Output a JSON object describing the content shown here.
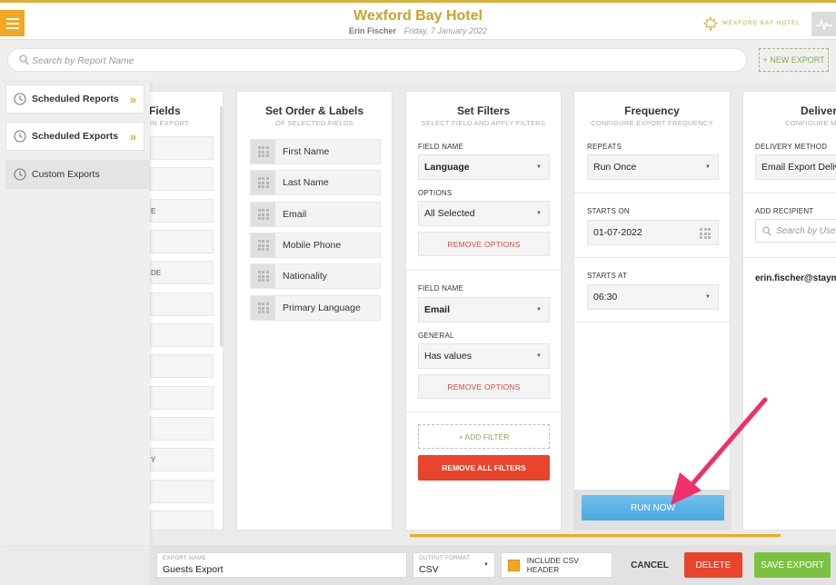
{
  "header": {
    "title": "Wexford Bay Hotel",
    "user": "Erin Fischer",
    "date": "Friday, 7 January 2022",
    "logo_text": "WEXFORD BAY HOTEL",
    "icons": {
      "menu": "hamburger-icon",
      "activity": "pulse-icon",
      "logo": "maple-leaf-icon"
    }
  },
  "search": {
    "placeholder": "Search by Report Name",
    "new_export_label": "+ NEW EXPORT"
  },
  "drawer": {
    "items": [
      {
        "label": "Scheduled Reports",
        "chevron": "»"
      },
      {
        "label": "Scheduled Exports",
        "chevron": "»"
      },
      {
        "label": "Custom Exports"
      }
    ]
  },
  "fields": {
    "title": "Fields",
    "subtitle": "IN EXPORT",
    "stubs": [
      "",
      "",
      "E",
      "",
      "DE",
      "",
      "",
      "",
      "",
      "",
      "Y",
      "",
      ""
    ]
  },
  "order": {
    "title": "Set Order & Labels",
    "subtitle": "OF SELECTED FIELDS",
    "items": [
      "First Name",
      "Last Name",
      "Email",
      "Mobile Phone",
      "Nationality",
      "Primary Language"
    ]
  },
  "filters": {
    "title": "Set Filters",
    "subtitle": "SELECT FIELD AND APPLY FILTERS",
    "groups": [
      {
        "field_label": "FIELD NAME",
        "field_value": "Language",
        "opt_label": "OPTIONS",
        "opt_value": "All Selected",
        "remove_label": "REMOVE OPTIONS"
      },
      {
        "field_label": "FIELD NAME",
        "field_value": "Email",
        "opt_label": "GENERAL",
        "opt_value": "Has values",
        "remove_label": "REMOVE OPTIONS"
      }
    ],
    "add_filter_label": "+ ADD FILTER",
    "remove_all_label": "REMOVE ALL FILTERS"
  },
  "frequency": {
    "title": "Frequency",
    "subtitle": "CONFIGURE EXPORT FREQUENCY",
    "repeats_label": "REPEATS",
    "repeats_value": "Run Once",
    "starts_on_label": "STARTS ON",
    "starts_on_value": "01-07-2022",
    "starts_at_label": "STARTS AT",
    "starts_at_value": "06:30",
    "run_now_label": "RUN NOW"
  },
  "delivery": {
    "title": "Deliver",
    "subtitle": "CONFIGURE ME",
    "method_label": "DELIVERY METHOD",
    "method_value": "Email Export Deliv",
    "recipient_label": "ADD RECIPIENT",
    "recipient_placeholder": "Search by User",
    "recipient_email": "erin.fischer@staym"
  },
  "bottom": {
    "export_name_caption": "EXPORT NAME",
    "export_name_value": "Guests Export",
    "format_caption": "OUTPUT FORMAT",
    "format_value": "CSV",
    "csv_header_label": "INCLUDE CSV HEADER",
    "cancel_label": "CANCEL",
    "delete_label": "DELETE",
    "save_label": "SAVE EXPORT"
  },
  "colors": {
    "brand_gold": "#c9a227",
    "accent_orange": "#f5a623",
    "danger": "#e8442c",
    "success": "#7cc242",
    "run_blue": "#4aa8e0",
    "annotation": "#f0306a"
  }
}
